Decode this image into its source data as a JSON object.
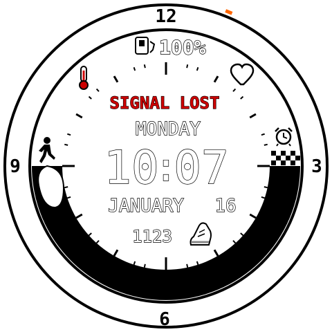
{
  "watch_face": {
    "dial_numbers": {
      "twelve": "12",
      "three": "3",
      "six": "6",
      "nine": "9"
    },
    "battery": {
      "percent_label": "100%"
    },
    "signal": {
      "label": "SIGNAL LOST",
      "color": "#cc0000"
    },
    "weekday": "MONDAY",
    "time": {
      "hours": "10",
      "separator": ":",
      "minutes": "07"
    },
    "date": {
      "month": "JANUARY",
      "day": "16"
    },
    "steps": {
      "count": "1123"
    },
    "step_goal_progress": 0.72,
    "icons": {
      "battery": "battery-charging-icon",
      "temperature": "thermometer-icon",
      "heart_rate": "heart-icon",
      "alarm": "alarm-clock-icon",
      "flag": "checkered-flag-icon",
      "walking": "walking-person-icon",
      "shoe": "running-shoe-icon"
    },
    "colors": {
      "accent_marker": "#ff6600",
      "signal_text": "#cc0000",
      "ink": "#000000",
      "background": "#ffffff"
    }
  }
}
